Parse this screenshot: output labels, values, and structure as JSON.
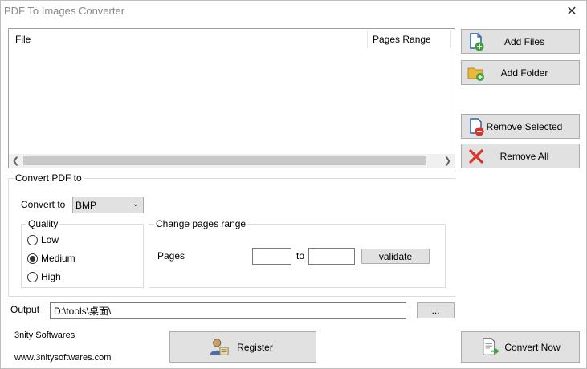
{
  "window": {
    "title": "PDF To Images Converter",
    "close_icon": "close-icon"
  },
  "file_list": {
    "columns": [
      "File",
      "Pages Range"
    ],
    "rows": []
  },
  "side_buttons": {
    "add_files": "Add Files",
    "add_folder": "Add Folder",
    "remove_selected": "Remove Selected",
    "remove_all": "Remove All"
  },
  "convert_group": {
    "legend": "Convert PDF to",
    "convert_to_label": "Convert to",
    "format_selected": "BMP",
    "quality": {
      "legend": "Quality",
      "options": [
        "Low",
        "Medium",
        "High"
      ],
      "selected": "Medium"
    },
    "pages_range": {
      "legend": "Change pages range",
      "pages_label": "Pages",
      "from_value": "",
      "to_label": "to",
      "to_value": "",
      "validate_label": "validate"
    }
  },
  "output": {
    "label": "Output",
    "path": "D:\\tools\\桌面\\",
    "browse_label": "..."
  },
  "footer": {
    "company": "3nity Softwares",
    "website": "www.3nitysoftwares.com",
    "register_label": "Register",
    "convert_now_label": "Convert Now"
  },
  "colors": {
    "button_bg": "#e1e1e1",
    "button_border": "#adadad",
    "add_green": "#3aa33a",
    "remove_red": "#d9342b",
    "file_blue": "#2b5fa8",
    "folder_yellow": "#e8b93a"
  }
}
